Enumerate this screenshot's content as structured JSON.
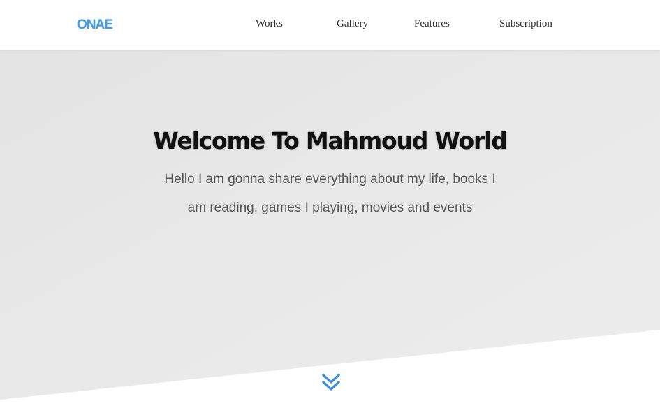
{
  "header": {
    "logo": "ONAE",
    "nav": [
      "Works",
      "Gallery",
      "Features",
      "Subscription"
    ]
  },
  "hero": {
    "title": "Welcome To Mahmoud World",
    "text": "Hello I am gonna share everything about my life, books I am reading, games I playing, movies and events"
  },
  "colors": {
    "accent": "#4a9ad8",
    "hero_background": "#e9e9e9",
    "page_background": "#ffffff",
    "title": "#111111",
    "body_text": "#555555"
  },
  "icons": {
    "scroll_down": "chevron-down-icon"
  }
}
